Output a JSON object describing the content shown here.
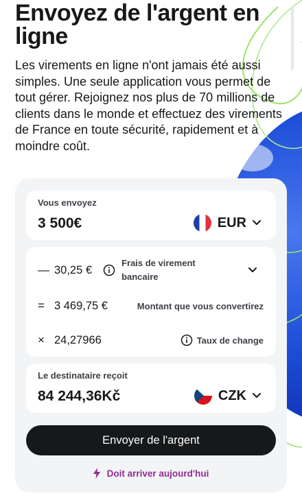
{
  "hero": {
    "title": "Envoyez de l'argent en ligne",
    "text": "Les virements en ligne n'ont jamais été aussi simples. Une seule application vous permet de tout gérer. Rejoignez nos plus de 70 millions de clients dans le monde et effectuez des virements de France en toute sécurité, rapidement et à moindre coût."
  },
  "send": {
    "label": "Vous envoyez",
    "amount": "3 500€",
    "currency": "EUR",
    "flag_icon": "france-flag-icon"
  },
  "fees": {
    "fee_symbol": "—",
    "fee_value": "30,25 €",
    "fee_label": "Frais de virement bancaire",
    "converted_symbol": "=",
    "converted_value": "3 469,75 €",
    "converted_label": "Montant que vous convertirez",
    "rate_symbol": "×",
    "rate_value": "24,27966",
    "rate_label": "Taux de change"
  },
  "receive": {
    "label": "Le destinataire reçoit",
    "amount": "84 244,36Kč",
    "currency": "CZK",
    "flag_icon": "czech-flag-icon"
  },
  "cta": {
    "label": "Envoyer de l'argent"
  },
  "arrival": {
    "text": "Doit arriver aujourd'hui",
    "icon": "lightning-icon"
  },
  "colors": {
    "primary_button": "#16181a",
    "card_bg": "#f3f4f6",
    "arrival_text": "#8e2d8e",
    "globe": "#1d4ed8",
    "wire": "#9be36a"
  }
}
